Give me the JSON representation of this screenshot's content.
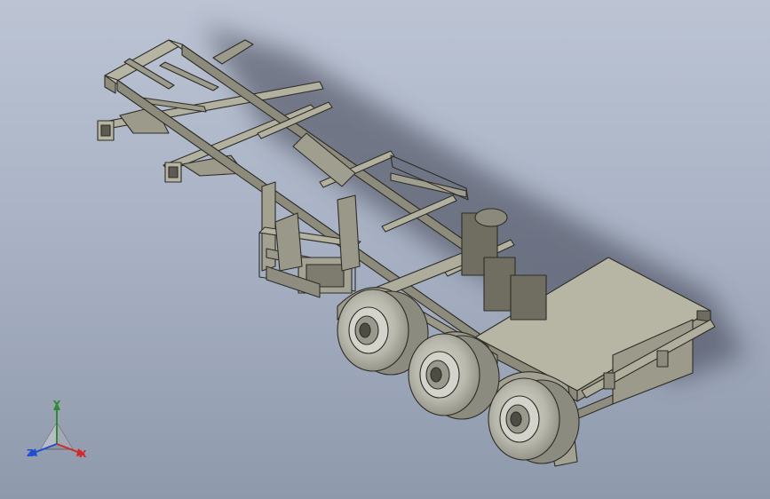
{
  "viewport": {
    "background_top": "#bcc4d4",
    "background_bottom": "#8f99ac",
    "model_color": "#a8a695",
    "model_edge_color": "#2e2d27"
  },
  "triad": {
    "x_label": "X",
    "y_label": "Y",
    "z_label": "Z",
    "x_color": "#d22a2a",
    "y_color": "#2e8b2e",
    "z_color": "#1f4fcf"
  }
}
